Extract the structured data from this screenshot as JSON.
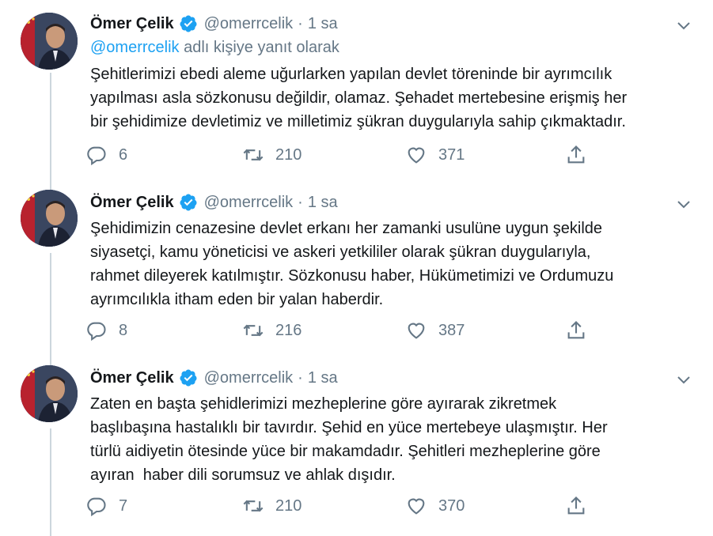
{
  "colors": {
    "accent": "#1da1f2",
    "muted": "#657786",
    "text": "#14171a",
    "thread": "#ccd6dd"
  },
  "tweets": [
    {
      "name": "Ömer Çelik",
      "handle": "@omerrcelik",
      "dot": "·",
      "time": "1 sa",
      "reply_prefix_mention": "@omerrcelik",
      "reply_suffix": " adlı kişiye yanıt olarak",
      "text": "Şehitlerimizi ebedi aleme uğurlarken yapılan devlet töreninde bir ayrımcılık\nyapılması asla sözkonusu değildir, olamaz. Şehadet mertebesine erişmiş her\nbir şehidimize devletimiz ve milletimiz şükran duygularıyla sahip çıkmaktadır.",
      "replies": "6",
      "retweets": "210",
      "likes": "371"
    },
    {
      "name": "Ömer Çelik",
      "handle": "@omerrcelik",
      "dot": "·",
      "time": "1 sa",
      "text": "Şehidimizin cenazesine devlet erkanı her zamanki usulüne uygun şekilde\nsiyasetçi, kamu yöneticisi ve askeri yetkililer olarak şükran duygularıyla,\nrahmet dileyerek katılmıştır. Sözkonusu haber, Hükümetimizi ve Ordumuzu\nayrımcılıkla itham eden bir yalan haberdir.",
      "replies": "8",
      "retweets": "216",
      "likes": "387"
    },
    {
      "name": "Ömer Çelik",
      "handle": "@omerrcelik",
      "dot": "·",
      "time": "1 sa",
      "text": "Zaten en başta şehidlerimizi mezheplerine göre ayırarak zikretmek\nbaşlıbaşına hastalıklı bir tavırdır. Şehid en yüce mertebeye ulaşmıştır. Her\ntürlü aidiyetin ötesinde yüce bir makamdadır. Şehitleri mezheplerine göre\nayıran  haber dili sorumsuz ve ahlak dışıdır.",
      "replies": "7",
      "retweets": "210",
      "likes": "370"
    }
  ],
  "icons": {
    "verified": "verified-badge-icon",
    "chevron": "chevron-down-icon",
    "reply": "reply-icon",
    "retweet": "retweet-icon",
    "like": "heart-icon",
    "share": "share-icon"
  }
}
